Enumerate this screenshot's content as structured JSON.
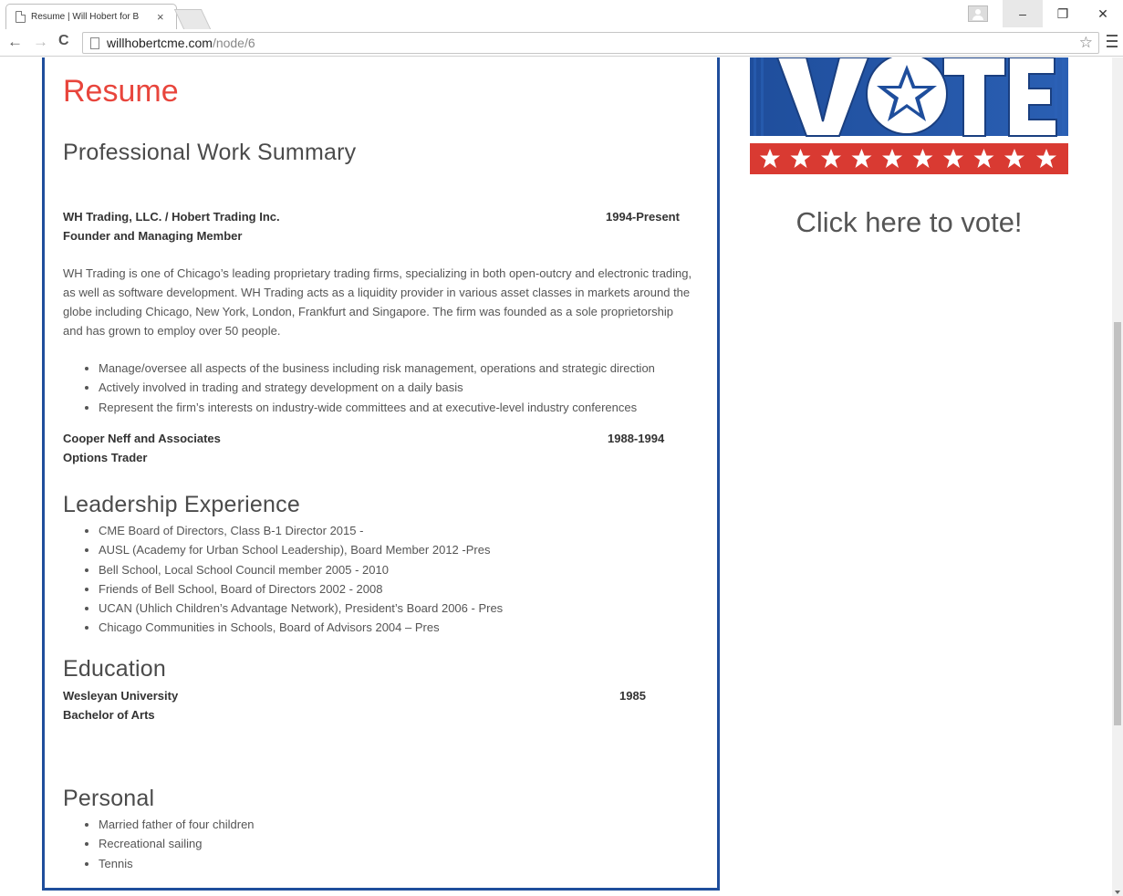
{
  "browser": {
    "tab_title": "Resume | Will Hobert for B",
    "tab_close": "×",
    "url_host": "willhobertcme.com",
    "url_path": "/node/6",
    "back_label": "←",
    "forward_label": "→",
    "reload_label": "C",
    "star_label": "☆",
    "minimize_label": "–",
    "restore_label": "❐",
    "close_label": "✕"
  },
  "resume": {
    "title": "Resume",
    "work_heading": "Professional Work Summary",
    "jobs": [
      {
        "company": "WH Trading, LLC. / Hobert Trading Inc.",
        "role": "Founder and Managing Member",
        "dates": "1994-Present",
        "description": "WH Trading is one of Chicago’s leading proprietary trading firms, specializing in both open-outcry and electronic trading, as well as software development. WH Trading acts as a liquidity provider in various asset classes in markets around the globe including Chicago, New York, London, Frankfurt and Singapore.  The firm was founded as a sole proprietorship and has grown to employ over 50 people.",
        "bullets": [
          "Manage/oversee all aspects of the business including risk management, operations and strategic direction",
          "Actively involved in trading and strategy development on a daily basis",
          "Represent the firm’s interests on industry-wide committees and at executive-level industry conferences"
        ]
      },
      {
        "company": "Cooper Neff and Associates",
        "role": "Options Trader",
        "dates": "1988-1994"
      }
    ],
    "leadership_heading": "Leadership Experience",
    "leadership": [
      "CME Board of Directors, Class B-1 Director 2015 -",
      "AUSL (Academy for Urban School Leadership), Board Member 2012 -Pres",
      "Bell School, Local School Council member 2005 - 2010",
      "Friends of Bell School, Board of Directors  2002 - 2008",
      "UCAN (Uhlich Children’s Advantage Network), President’s Board 2006 - Pres",
      "Chicago Communities in Schools, Board of Advisors  2004 – Pres"
    ],
    "education_heading": "Education",
    "education": {
      "school": "Wesleyan University",
      "degree": "Bachelor of Arts",
      "year": "1985"
    },
    "personal_heading": "Personal",
    "personal": [
      "Married father of four children",
      "Recreational sailing",
      "Tennis"
    ]
  },
  "sidebar": {
    "vote_banner_text": "VOTE",
    "vote_link": "Click here to vote!"
  },
  "colors": {
    "resume_title": "#e8453c",
    "box_border": "#1f4e9c",
    "vote_blue": "#1f4e9c",
    "vote_red": "#d93a32"
  }
}
